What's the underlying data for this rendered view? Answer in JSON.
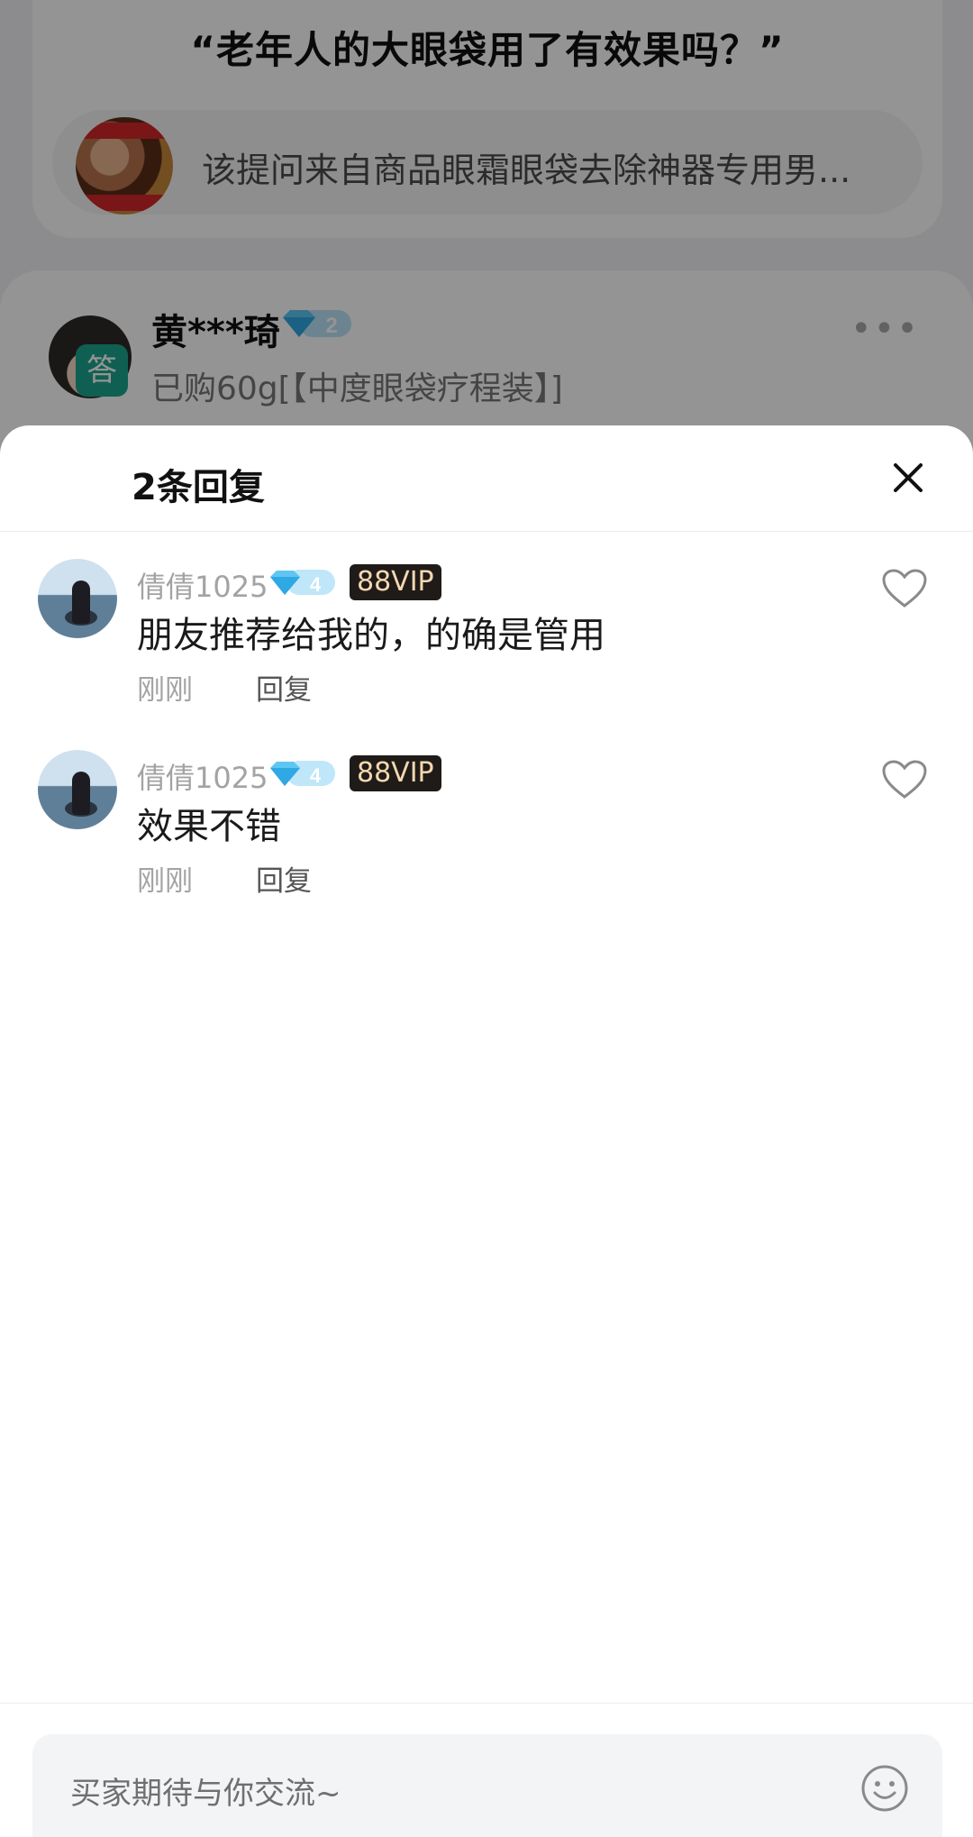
{
  "background": {
    "question": {
      "title": "“老年人的大眼袋用了有效果吗？”",
      "source_text": "该提问来自商品眼霜眼袋去除神器专用男..."
    },
    "answer": {
      "badge": "答",
      "username": "黄***琦",
      "level": "2",
      "purchase": "已购60g[【中度眼袋疗程装】]",
      "more_icon": "more-dots-icon"
    }
  },
  "sheet": {
    "title": "2条回复",
    "close_icon": "close-icon",
    "replies": [
      {
        "username": "倩倩1025",
        "level": "4",
        "vip": "88VIP",
        "text": "朋友推荐给我的，的确是管用",
        "time": "刚刚",
        "reply_label": "回复"
      },
      {
        "username": "倩倩1025",
        "level": "4",
        "vip": "88VIP",
        "text": "效果不错",
        "time": "刚刚",
        "reply_label": "回复"
      }
    ],
    "input": {
      "placeholder": "买家期待与你交流~",
      "emoji_icon": "smile-emoji-icon"
    }
  },
  "colors": {
    "accent_teal": "#1aa58e",
    "diamond_blue": "#5ec6f2",
    "vip_bg": "#1f1b18",
    "vip_text": "#f4d7b0"
  }
}
